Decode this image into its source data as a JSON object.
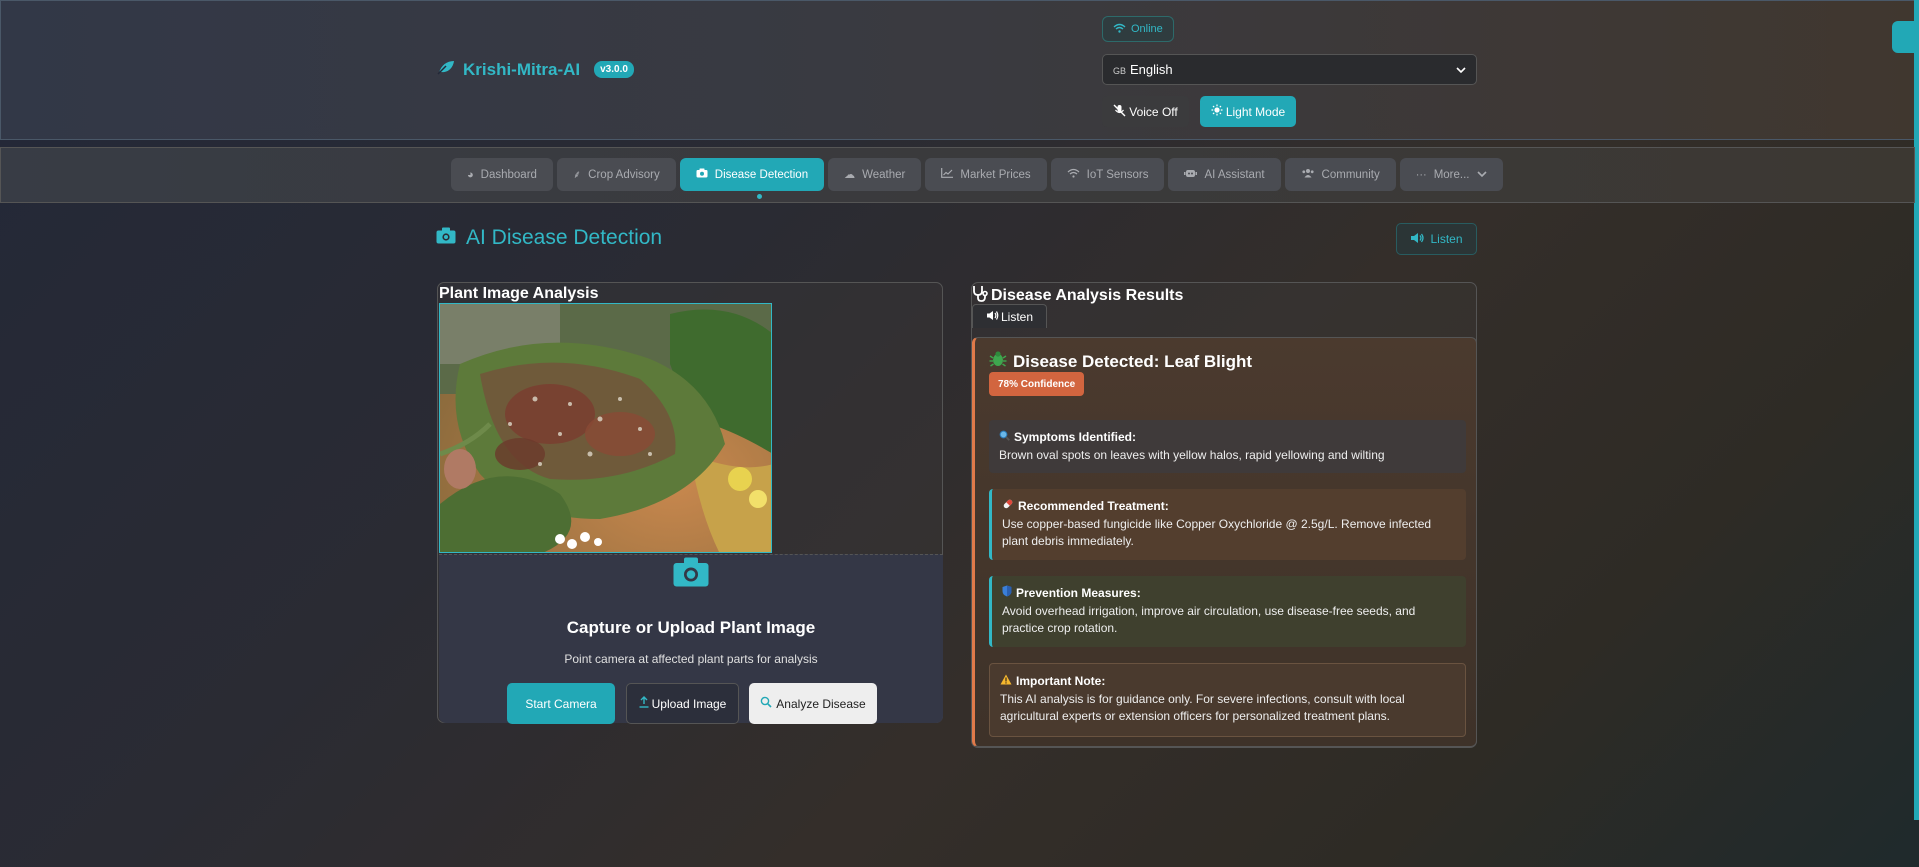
{
  "header": {
    "brand_name": "Krishi-Mitra-AI",
    "version": "v3.0.0",
    "status": "Online",
    "language_flag": "GB",
    "language": "English",
    "voice_label": "Voice Off",
    "theme_label": "Light Mode"
  },
  "nav": {
    "tabs": [
      {
        "label": "Dashboard",
        "icon": "gauge-icon",
        "active": false
      },
      {
        "label": "Crop Advisory",
        "icon": "seedling-icon",
        "active": false
      },
      {
        "label": "Disease Detection",
        "icon": "camera-icon",
        "active": true
      },
      {
        "label": "Weather",
        "icon": "cloud-icon",
        "active": false
      },
      {
        "label": "Market Prices",
        "icon": "chart-line-icon",
        "active": false
      },
      {
        "label": "IoT Sensors",
        "icon": "wifi-icon",
        "active": false
      },
      {
        "label": "AI Assistant",
        "icon": "robot-icon",
        "active": false
      },
      {
        "label": "Community",
        "icon": "users-icon",
        "active": false
      },
      {
        "label": "More...",
        "icon": "ellipsis-icon",
        "active": false
      }
    ]
  },
  "page": {
    "title": "AI Disease Detection",
    "listen_label": "Listen"
  },
  "analysis": {
    "heading": "Plant Image Analysis",
    "upload_title": "Capture or Upload Plant Image",
    "upload_subtitle": "Point camera at affected plant parts for analysis",
    "start_camera": "Start Camera",
    "upload_image": "Upload Image",
    "analyze": "Analyze Disease"
  },
  "results": {
    "heading": "Disease Analysis Results",
    "listen_label": "Listen",
    "disease_title": "Disease Detected: Leaf Blight",
    "confidence": "78% Confidence",
    "symptoms_label": "Symptoms Identified:",
    "symptoms_text": "Brown oval spots on leaves with yellow halos, rapid yellowing and wilting",
    "treatment_label": "Recommended Treatment:",
    "treatment_text": "Use copper-based fungicide like Copper Oxychloride @ 2.5g/L. Remove infected plant debris immediately.",
    "prevention_label": "Prevention Measures:",
    "prevention_text": "Avoid overhead irrigation, improve air circulation, use disease-free seeds, and practice crop rotation.",
    "note_label": "Important Note:",
    "note_text": "This AI analysis is for guidance only. For severe infections, consult with local agricultural experts or extension officers for personalized treatment plans."
  },
  "colors": {
    "accent": "#22a8b6",
    "confidence_badge": "#d2653f",
    "result_border": "#e07a4a"
  }
}
